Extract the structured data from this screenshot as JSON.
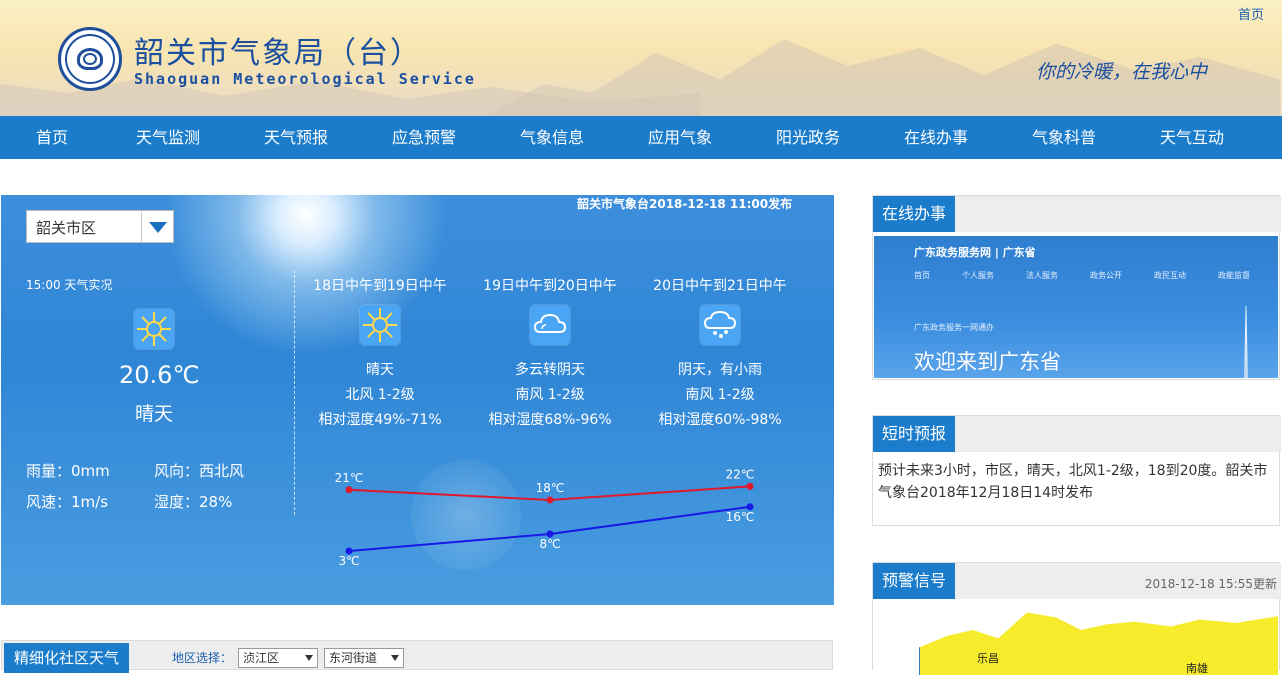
{
  "header": {
    "title": "韶关市气象局（台）",
    "subtitle": "Shaoguan Meteorological Service",
    "home_link": "首页",
    "slogan": "你的冷暖，在我心中"
  },
  "nav": [
    "首页",
    "天气监测",
    "天气预报",
    "应急预警",
    "气象信息",
    "应用气象",
    "阳光政务",
    "在线办事",
    "气象科普",
    "天气互动"
  ],
  "weather": {
    "publish": "韶关市气象台2018-12-18 11:00发布",
    "city_select": "韶关市区",
    "now": {
      "label": "15:00 天气实况",
      "icon": "sun-icon",
      "temp": "20.6℃",
      "desc": "晴天",
      "rain": "雨量：0mm",
      "wind_dir": "风向：西北风",
      "wind_speed": "风速：1m/s",
      "humidity": "湿度：28%"
    },
    "forecasts": [
      {
        "period": "18日中午到19日中午",
        "icon": "sun-icon",
        "desc": "晴天",
        "wind": "北风 1-2级",
        "humidity": "相对湿度49%-71%"
      },
      {
        "period": "19日中午到20日中午",
        "icon": "cloud-icon",
        "desc": "多云转阴天",
        "wind": "南风 1-2级",
        "humidity": "相对湿度68%-96%"
      },
      {
        "period": "20日中午到21日中午",
        "icon": "rain-cloud-icon",
        "desc": "阴天，有小雨",
        "wind": "南风 1-2级",
        "humidity": "相对湿度60%-98%"
      }
    ],
    "temps": {
      "high": [
        21,
        18,
        22
      ],
      "low": [
        3,
        8,
        16
      ],
      "high_labels": [
        "21℃",
        "18℃",
        "22℃"
      ],
      "low_labels": [
        "3℃",
        "8℃",
        "16℃"
      ],
      "high_color": "#e0192b",
      "low_color": "#1919e6"
    }
  },
  "sidebar": {
    "online": {
      "tab": "在线办事",
      "banner": {
        "logo": "广东政务服务网  |  广东省",
        "menu": [
          "首页",
          "个人服务",
          "法人服务",
          "政务公开",
          "政民互动",
          "政能监督"
        ],
        "sub": "广东政务服务一网通办",
        "welcome": "欢迎来到广东省"
      }
    },
    "short": {
      "tab": "短时预报",
      "text": "预计未来3小时，市区，晴天，北风1-2级，18到20度。韶关市气象台2018年12月18日14时发布"
    },
    "warning": {
      "tab": "预警信号",
      "updated": "2018-12-18 15:55更新",
      "cities": [
        "乐昌",
        "南雄"
      ]
    }
  },
  "community": {
    "tab": "精细化社区天气",
    "region_label": "地区选择：",
    "district": "浈江区",
    "street": "东河街道"
  }
}
